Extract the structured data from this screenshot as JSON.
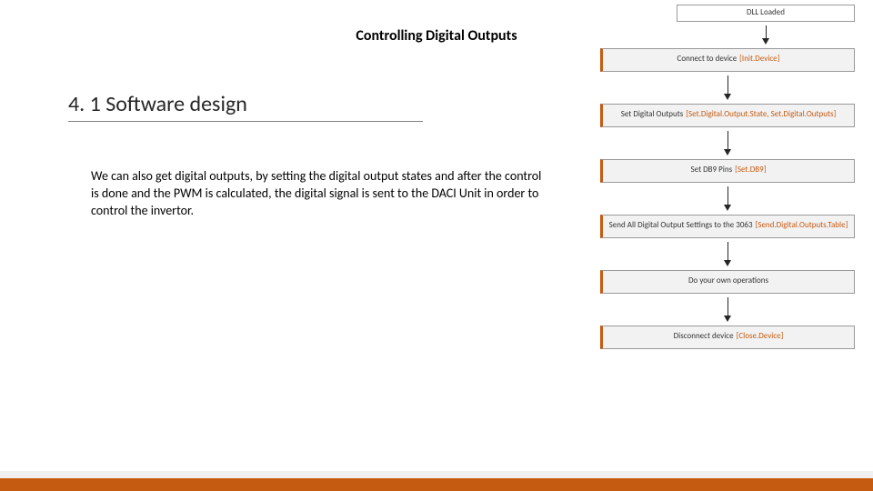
{
  "title": "Controlling Digital Outputs",
  "heading": "4. 1 Software design",
  "body": "We can also get digital outputs, by setting the digital output states and after the control is done and the PWM is calculated, the digital signal is sent to the DACI Unit in order to control the invertor.",
  "flow": {
    "start": "DLL Loaded",
    "steps": [
      {
        "label": "Connect to device",
        "api": "[Init.Device]"
      },
      {
        "label": "Set Digital Outputs",
        "api": "[Set.Digital.Output.State, Set.Digital.Outputs]"
      },
      {
        "label": "Set DB9 Pins",
        "api": "[Set.DB9]"
      },
      {
        "label": "Send All Digital Output Settings to the 3063",
        "api": "[Send.Digital.Outputs.Table]"
      },
      {
        "label": "Do your own operations",
        "api": ""
      },
      {
        "label": "Disconnect device",
        "api": "[Close.Device]"
      }
    ]
  }
}
